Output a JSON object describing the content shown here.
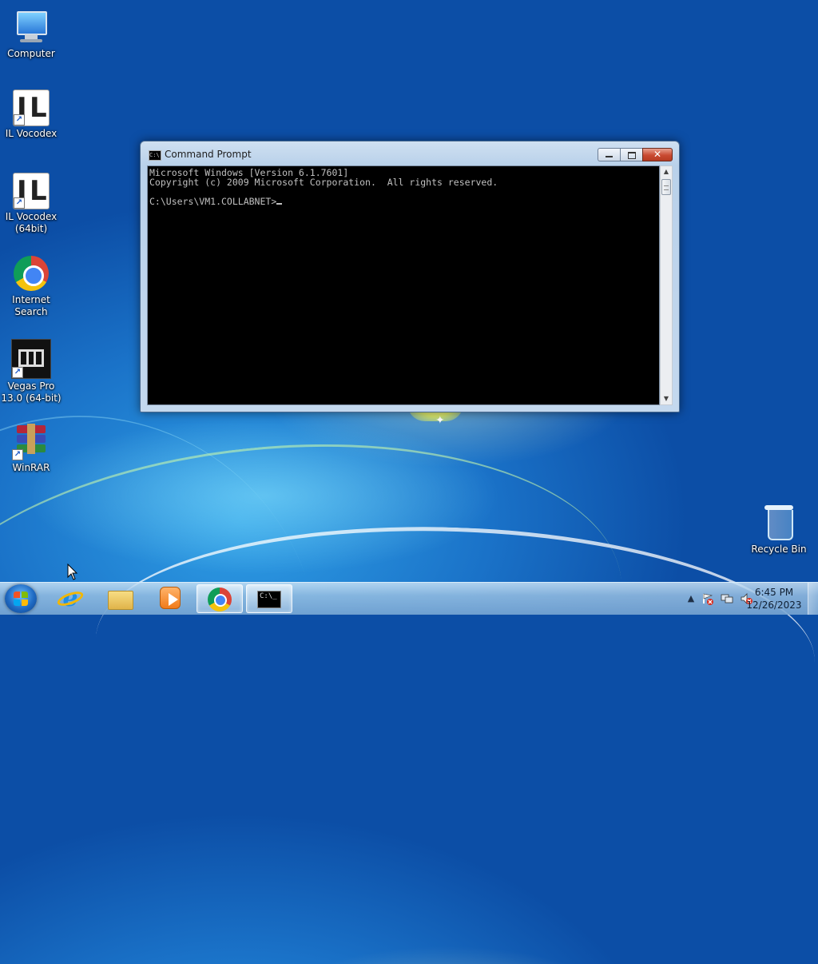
{
  "desktop": {
    "icons": [
      {
        "label": "Computer",
        "icon": "computer-icon"
      },
      {
        "label": "IL Vocodex",
        "icon": "il-vocodex-icon"
      },
      {
        "label": "IL Vocodex\n(64bit)",
        "icon": "il-vocodex-64-icon"
      },
      {
        "label": "Internet\nSearch",
        "icon": "chrome-icon"
      },
      {
        "label": "Vegas Pro\n13.0 (64-bit)",
        "icon": "vegas-pro-icon"
      },
      {
        "label": "WinRAR",
        "icon": "winrar-icon"
      }
    ],
    "recycle_bin": {
      "label": "Recycle Bin",
      "icon": "recycle-bin-icon"
    }
  },
  "cmd_window": {
    "title": "Command Prompt",
    "icon": "cmd-icon",
    "console_text": "Microsoft Windows [Version 6.1.7601]\nCopyright (c) 2009 Microsoft Corporation.  All rights reserved.\n\nC:\\Users\\VM1.COLLABNET>",
    "buttons": {
      "minimize": "minimize",
      "maximize": "maximize",
      "close": "✕"
    },
    "cmd_icon_text": "C:\\"
  },
  "taskbar": {
    "start_icon": "windows-start-icon",
    "pinned": [
      {
        "name": "internet-explorer",
        "icon": "ie-icon",
        "active": false
      },
      {
        "name": "windows-explorer",
        "icon": "folder-icon",
        "active": false
      },
      {
        "name": "windows-media-player",
        "icon": "media-player-icon",
        "active": false
      },
      {
        "name": "google-chrome",
        "icon": "chrome-icon",
        "active": true
      },
      {
        "name": "command-prompt",
        "icon": "cmd-icon",
        "active": true
      }
    ],
    "cmd_glyph": "C:\\_",
    "tray": {
      "show_hidden": "▲",
      "icons": [
        "action-center-icon",
        "network-icon",
        "volume-muted-icon"
      ]
    },
    "clock": {
      "time": "6:45 PM",
      "date": "12/26/2023"
    }
  },
  "colors": {
    "desktop": "#1a72c8",
    "console_bg": "#000000",
    "console_fg": "#c0c0c0",
    "close_btn": "#c94a32"
  }
}
